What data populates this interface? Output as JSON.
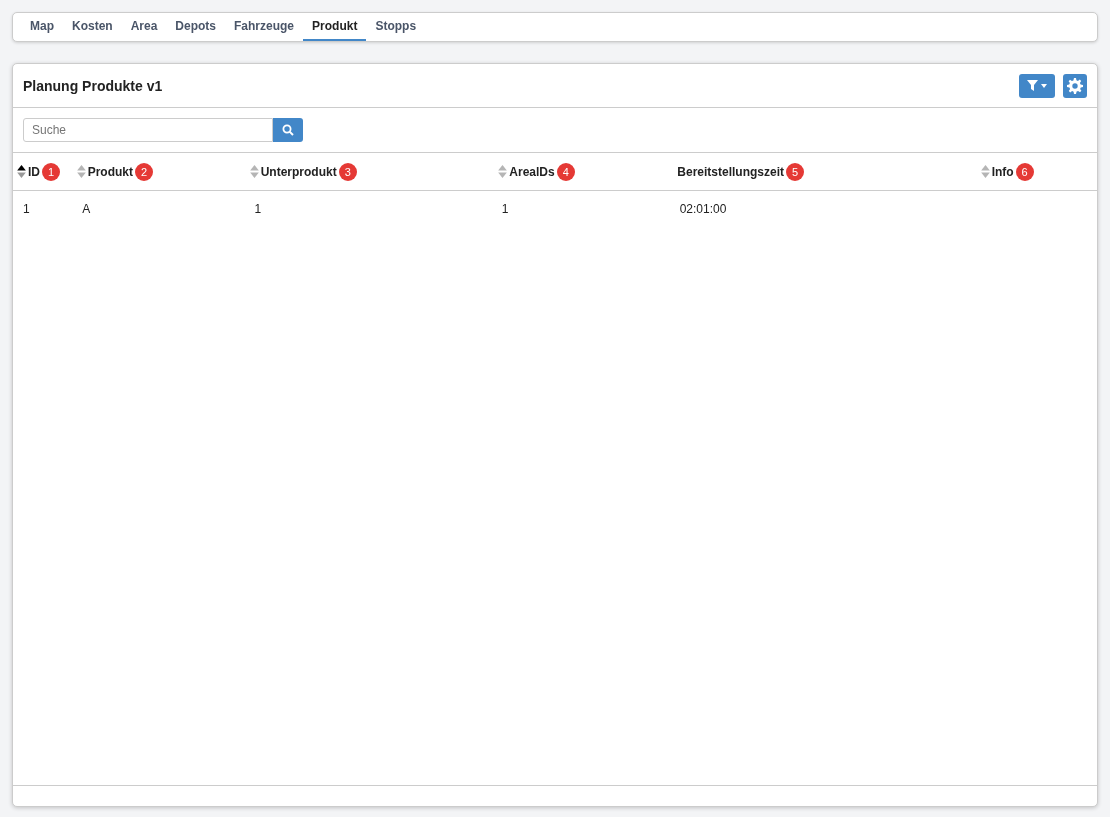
{
  "tabs": [
    {
      "label": "Map",
      "selected": false
    },
    {
      "label": "Kosten",
      "selected": false
    },
    {
      "label": "Area",
      "selected": false
    },
    {
      "label": "Depots",
      "selected": false
    },
    {
      "label": "Fahrzeuge",
      "selected": false
    },
    {
      "label": "Produkt",
      "selected": true
    },
    {
      "label": "Stopps",
      "selected": false
    }
  ],
  "panel": {
    "title": "Planung Produkte v1",
    "search": {
      "placeholder": "Suche"
    },
    "table": {
      "columns": [
        {
          "label": "ID",
          "sortable": true,
          "sorted": true,
          "badge": "1"
        },
        {
          "label": "Produkt",
          "sortable": true,
          "sorted": false,
          "badge": "2"
        },
        {
          "label": "Unterprodukt",
          "sortable": true,
          "sorted": false,
          "badge": "3"
        },
        {
          "label": "ArealDs",
          "sortable": true,
          "sorted": false,
          "badge": "4"
        },
        {
          "label": "Bereitstellungszeit",
          "sortable": false,
          "badge": "5"
        },
        {
          "label": "Info",
          "sortable": true,
          "sorted": false,
          "badge": "6"
        }
      ],
      "rows": [
        [
          "1",
          "A",
          "1",
          "1",
          "02:01:00",
          ""
        ]
      ]
    }
  }
}
